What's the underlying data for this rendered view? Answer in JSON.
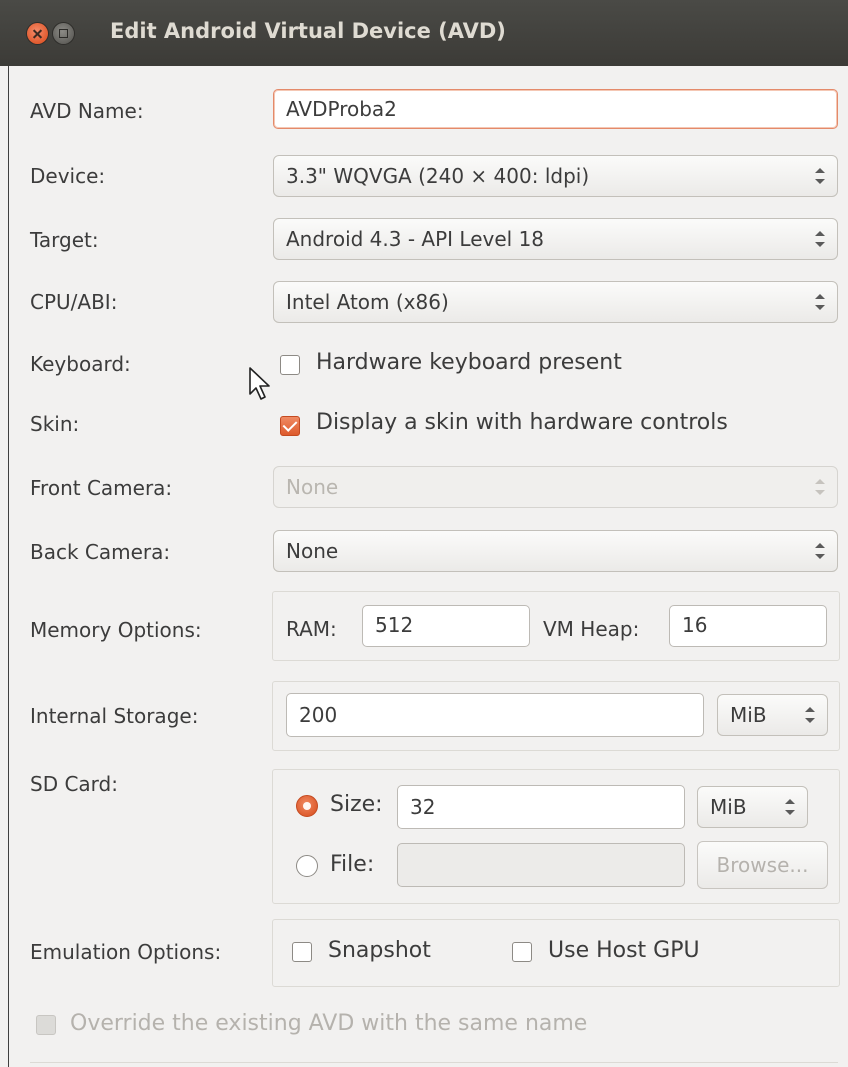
{
  "window": {
    "title": "Edit Android Virtual Device (AVD)"
  },
  "form": {
    "avd_name": {
      "label": "AVD Name:",
      "value": "AVDProba2"
    },
    "device": {
      "label": "Device:",
      "value": "3.3\" WQVGA (240 × 400: ldpi)"
    },
    "target": {
      "label": "Target:",
      "value": "Android 4.3 - API Level 18"
    },
    "cpu_abi": {
      "label": "CPU/ABI:",
      "value": "Intel Atom (x86)"
    },
    "keyboard": {
      "label": "Keyboard:",
      "option_label": "Hardware keyboard present",
      "checked": false
    },
    "skin": {
      "label": "Skin:",
      "option_label": "Display a skin with hardware controls",
      "checked": true
    },
    "front_camera": {
      "label": "Front Camera:",
      "value": "None",
      "enabled": false
    },
    "back_camera": {
      "label": "Back Camera:",
      "value": "None"
    },
    "memory": {
      "label": "Memory Options:",
      "ram_label": "RAM:",
      "ram_value": "512",
      "vm_heap_label": "VM Heap:",
      "vm_heap_value": "16"
    },
    "internal_storage": {
      "label": "Internal Storage:",
      "value": "200",
      "unit": "MiB"
    },
    "sd_card": {
      "label": "SD Card:",
      "size_label": "Size:",
      "size_value": "32",
      "size_unit": "MiB",
      "size_selected": true,
      "file_label": "File:",
      "file_value": "",
      "browse_label": "Browse..."
    },
    "emulation": {
      "label": "Emulation Options:",
      "snapshot_label": "Snapshot",
      "snapshot_checked": false,
      "host_gpu_label": "Use Host GPU",
      "host_gpu_checked": false
    },
    "override": {
      "label": "Override the existing AVD with the same name",
      "checked": false,
      "enabled": false
    }
  },
  "colors": {
    "accent": "#dd5a2c",
    "titlebar": "#3c3b37",
    "background": "#f2f1f0"
  }
}
